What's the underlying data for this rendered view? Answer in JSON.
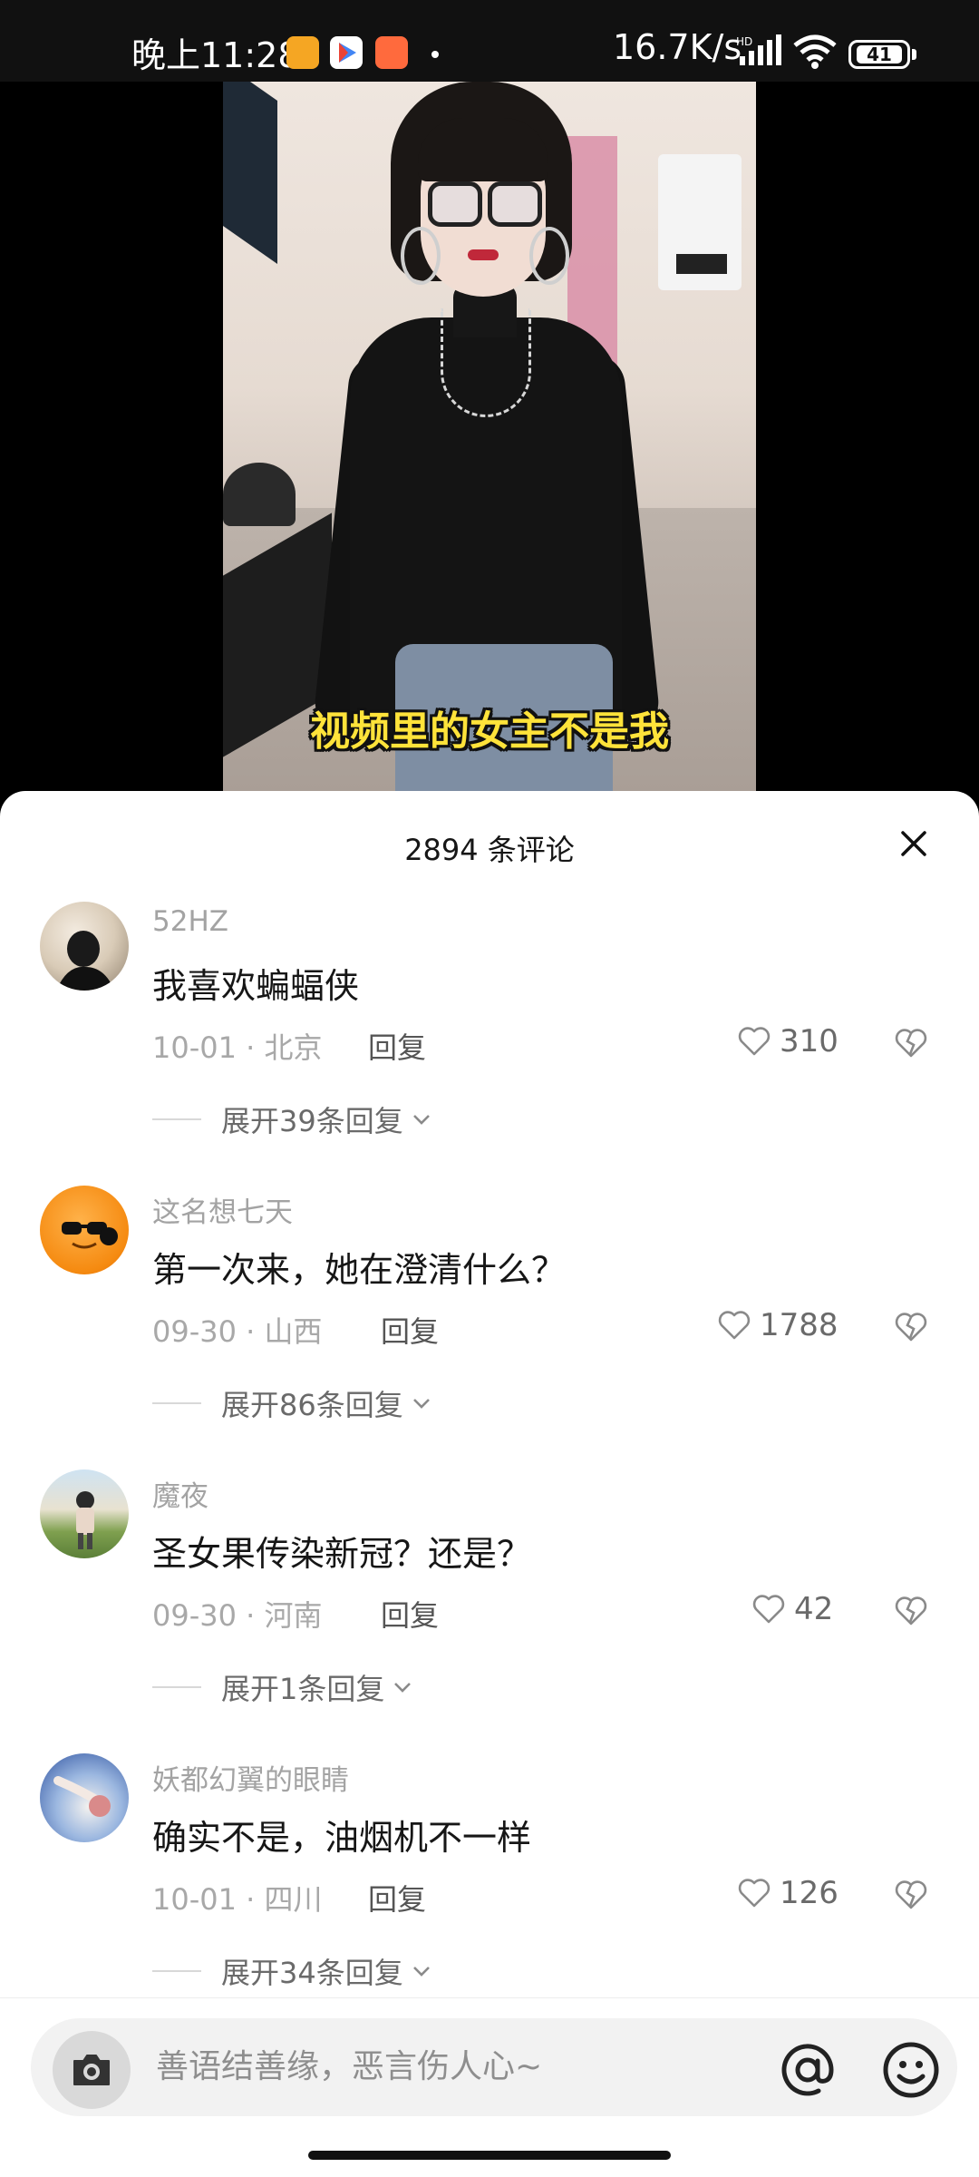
{
  "status_bar": {
    "time": "晚上11:28",
    "net_speed": "16.7K/s",
    "battery": "41",
    "app_icons": [
      "notes-app-icon",
      "play-store-icon",
      "shopping-app-icon"
    ]
  },
  "video": {
    "caption": "视频里的女主不是我"
  },
  "comments_sheet": {
    "title": "2894 条评论",
    "comments": [
      {
        "user": "52HZ",
        "text": "我喜欢蝙蝠侠",
        "date_location": "10-01 · 北京",
        "reply_label": "回复",
        "likes": "310",
        "expand_label": "展开39条回复"
      },
      {
        "user": "这名想七天",
        "text": "第一次来，她在澄清什么？",
        "date_location": "09-30 · 山西",
        "reply_label": "回复",
        "likes": "1788",
        "expand_label": "展开86条回复"
      },
      {
        "user": "魔夜",
        "text": "圣女果传染新冠？还是？",
        "date_location": "09-30 · 河南",
        "reply_label": "回复",
        "likes": "42",
        "expand_label": "展开1条回复"
      },
      {
        "user": "妖都幻翼的眼睛",
        "text": "确实不是，油烟机不一样",
        "date_location": "10-01 · 四川",
        "reply_label": "回复",
        "likes": "126",
        "expand_label": "展开34条回复"
      }
    ]
  },
  "input_bar": {
    "placeholder": "善语结善缘，恶言伤人心~"
  },
  "colors": {
    "sheet_background": "#ffffff",
    "caption_yellow": "#ffe33a",
    "muted_text": "#a8a8a8"
  }
}
